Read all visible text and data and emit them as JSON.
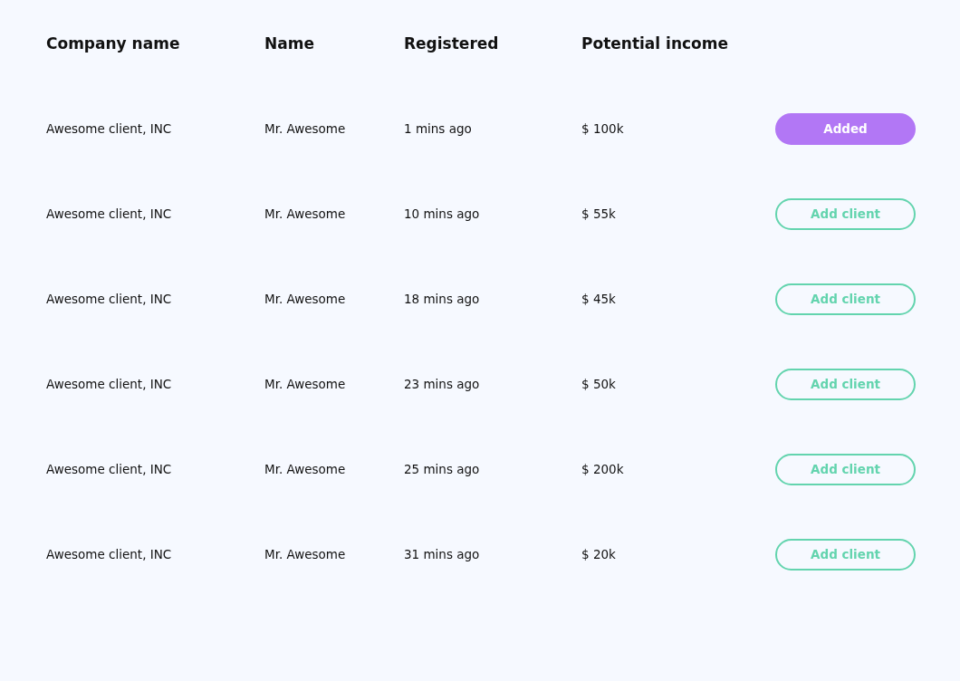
{
  "table": {
    "columns": [
      "Company name",
      "Name",
      "Registered",
      "Potential income"
    ],
    "rows": [
      {
        "company": "Awesome client, INC",
        "name": "Mr. Awesome",
        "registered": "1 mins ago",
        "income": "$ 100k",
        "added": true,
        "action": "Added"
      },
      {
        "company": "Awesome client, INC",
        "name": "Mr. Awesome",
        "registered": "10 mins ago",
        "income": "$ 55k",
        "added": false,
        "action": "Add client"
      },
      {
        "company": "Awesome client, INC",
        "name": "Mr. Awesome",
        "registered": "18 mins ago",
        "income": "$ 45k",
        "added": false,
        "action": "Add client"
      },
      {
        "company": "Awesome client, INC",
        "name": "Mr. Awesome",
        "registered": "23 mins ago",
        "income": "$ 50k",
        "added": false,
        "action": "Add client"
      },
      {
        "company": "Awesome client, INC",
        "name": "Mr. Awesome",
        "registered": "25 mins ago",
        "income": "$ 200k",
        "added": false,
        "action": "Add client"
      },
      {
        "company": "Awesome client, INC",
        "name": "Mr. Awesome",
        "registered": "31 mins ago",
        "income": "$ 20k",
        "added": false,
        "action": "Add client"
      }
    ]
  }
}
